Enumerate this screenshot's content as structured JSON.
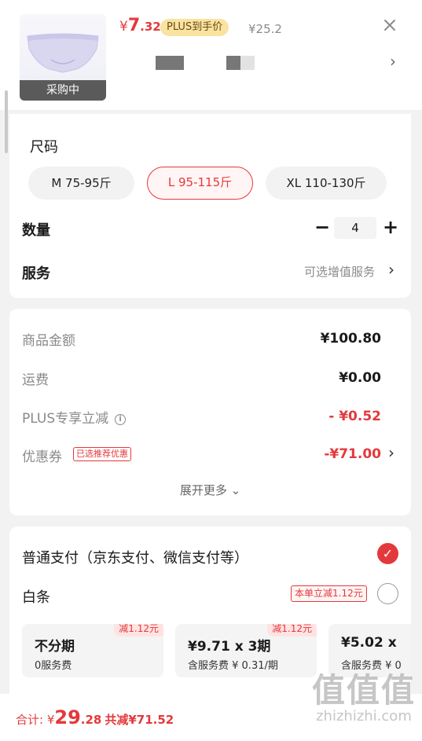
{
  "header": {
    "thumb_badge": "采购中",
    "price_symbol": "¥",
    "price_int": "7",
    "price_dec": ".32",
    "plus_tag": "PLUS到手价",
    "original_price": "¥25.2",
    "close_icon": "close-icon",
    "chevron": "›"
  },
  "spec": {
    "size_title": "尺码",
    "sizes": [
      {
        "label": "M 75-95斤",
        "selected": false
      },
      {
        "label": "L 95-115斤",
        "selected": true
      },
      {
        "label": "XL 110-130斤",
        "selected": false
      }
    ],
    "quantity_label": "数量",
    "quantity_minus": "−",
    "quantity_value": "4",
    "quantity_plus": "+",
    "service_label": "服务",
    "service_hint": "可选增值服务",
    "service_chevron": "›"
  },
  "summary": {
    "goods_label": "商品金额",
    "goods_value": "¥100.80",
    "shipping_label": "运费",
    "shipping_value": "¥0.00",
    "plus_label": "PLUS专享立减",
    "plus_value": "- ¥0.52",
    "coupon_label": "优惠券",
    "coupon_tag": "已选推荐优惠",
    "coupon_value": "-¥71.00",
    "coupon_chevron": "›",
    "expand": "展开更多",
    "expand_icon": "⌄"
  },
  "payment": {
    "normal_label": "普通支付（京东支付、微信支付等）",
    "normal_checked": true,
    "check_glyph": "✓",
    "baitiao_label": "白条",
    "baitiao_tag": "本单立减1.12元",
    "baitiao_checked": false,
    "plans": [
      {
        "title": "不分期",
        "sub": "0服务费",
        "badge": "减1.12元"
      },
      {
        "title": "¥9.71 x 3期",
        "sub": "含服务费 ¥ 0.31/期",
        "badge": "减1.12元"
      },
      {
        "title": "¥5.02 x",
        "sub": "含服务费 ¥ 0",
        "badge": ""
      }
    ]
  },
  "footer": {
    "total_label": "合计: ",
    "total_symbol": "¥",
    "total_int": "29",
    "total_dec": ".28",
    "total_saving": "共减¥71.52"
  },
  "watermark": {
    "glyphs": "值值值",
    "url": "zhizhizhi.com"
  },
  "colors": {
    "accent": "#e4393c",
    "plus_tag_bg": "#f9e3a1",
    "background": "#f2f2f2"
  }
}
